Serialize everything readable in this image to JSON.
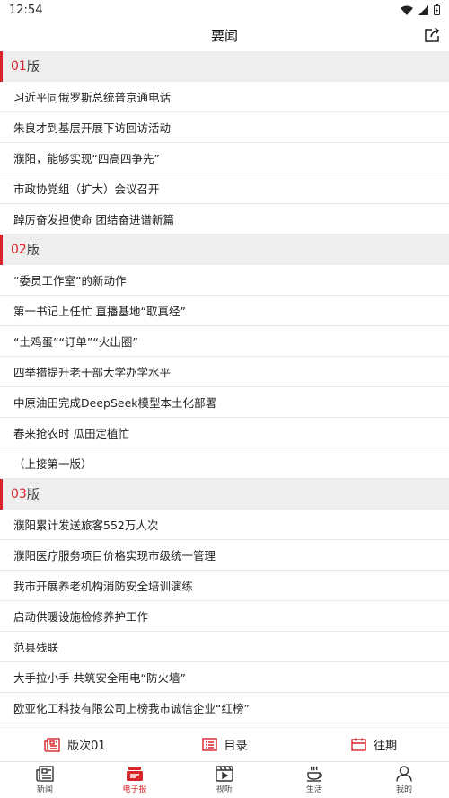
{
  "status": {
    "time": "12:54"
  },
  "header": {
    "title": "要闻"
  },
  "sections": [
    {
      "num": "01",
      "suffix": "版",
      "articles": [
        "习近平同俄罗斯总统普京通电话",
        "朱良才到基层开展下访回访活动",
        "濮阳，能够实现“四高四争先”",
        "市政协党组（扩大）会议召开",
        "踔厉奋发担使命 团结奋进谱新篇"
      ]
    },
    {
      "num": "02",
      "suffix": "版",
      "articles": [
        "“委员工作室”的新动作",
        "第一书记上任忙 直播基地“取真经”",
        "“土鸡蛋”“订单”“火出圈”",
        "四举措提升老干部大学办学水平",
        "中原油田完成DeepSeek模型本土化部署",
        "春来抢农时 瓜田定植忙",
        "（上接第一版）"
      ]
    },
    {
      "num": "03",
      "suffix": "版",
      "articles": [
        "濮阳累计发送旅客552万人次",
        "濮阳医疗服务项目价格实现市级统一管理",
        "我市开展养老机构消防安全培训演练",
        "启动供暖设施检修养护工作",
        "范县残联",
        "大手拉小手 共筑安全用电“防火墙”",
        "欧亚化工科技有限公司上榜我市诚信企业“红榜”"
      ]
    }
  ],
  "edition_bar": {
    "edition": "版次01",
    "catalog": "目录",
    "archive": "往期"
  },
  "tabs": [
    "新闻",
    "电子报",
    "视听",
    "生活",
    "我的"
  ],
  "colors": {
    "accent": "#d9242b",
    "section_bg": "#eeeeee"
  }
}
